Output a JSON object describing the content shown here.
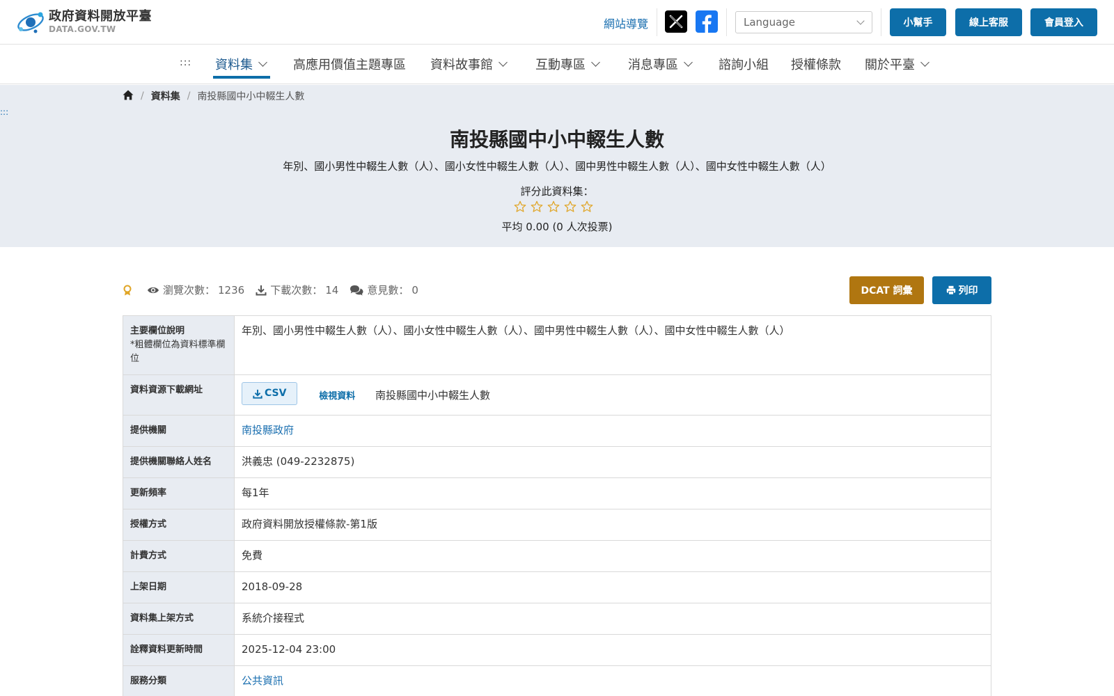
{
  "header": {
    "logo_title": "政府資料開放平臺",
    "logo_sub": "DATA.GOV.TW",
    "sitemap": "網站導覽",
    "language_placeholder": "Language",
    "buttons": [
      "小幫手",
      "線上客服",
      "會員登入"
    ]
  },
  "nav": {
    "accesskey": ":::",
    "items": [
      {
        "label": "資料集",
        "dropdown": true
      },
      {
        "label": "高應用價值主題專區",
        "dropdown": false
      },
      {
        "label": "資料故事館",
        "dropdown": true
      },
      {
        "label": "互動專區",
        "dropdown": true
      },
      {
        "label": "消息專區",
        "dropdown": true
      },
      {
        "label": "諮詢小組",
        "dropdown": false
      },
      {
        "label": "授權條款",
        "dropdown": false
      },
      {
        "label": "關於平臺",
        "dropdown": true
      }
    ]
  },
  "breadcrumb": {
    "level1": "資料集",
    "current": "南投縣國中小中輟生人數"
  },
  "hero": {
    "accesskey": ":::",
    "title": "南投縣國中小中輟生人數",
    "description": "年別、國小男性中輟生人數（人）、國小女性中輟生人數（人）、國中男性中輟生人數（人）、國中女性中輟生人數（人）",
    "rate_label": "評分此資料集：",
    "rating_value": 0,
    "rating_max": 5,
    "average": "平均 0.00 (0 人次投票)"
  },
  "stats": {
    "views_label": "瀏覽次數：",
    "views_value": "1236",
    "downloads_label": "下載次數：",
    "downloads_value": "14",
    "comments_label": "意見數：",
    "comments_value": "0"
  },
  "actions": {
    "dcat": "DCAT 詞彙",
    "print": "列印"
  },
  "details": {
    "main_fields_label": "主要欄位說明",
    "main_fields_note": "*粗體欄位為資料標準欄位",
    "main_fields_value": "年別、國小男性中輟生人數（人）、國小女性中輟生人數（人）、國中男性中輟生人數（人）、國中女性中輟生人數（人）",
    "resource_label": "資料資源下載網址",
    "csv_label": "CSV",
    "view_label": "檢視資料",
    "resource_name": "南投縣國中小中輟生人數",
    "rows": [
      {
        "label": "提供機關",
        "value": "南投縣政府",
        "link": true
      },
      {
        "label": "提供機關聯絡人姓名",
        "value": "洪義忠 (049-2232875)",
        "link": false
      },
      {
        "label": "更新頻率",
        "value": "每1年",
        "link": false
      },
      {
        "label": "授權方式",
        "value": "政府資料開放授權條款-第1版",
        "link": false
      },
      {
        "label": "計費方式",
        "value": "免費",
        "link": false
      },
      {
        "label": "上架日期",
        "value": "2018-09-28",
        "link": false
      },
      {
        "label": "資料集上架方式",
        "value": "系統介接程式",
        "link": false
      },
      {
        "label": "詮釋資料更新時間",
        "value": "2025-12-04 23:00",
        "link": false
      },
      {
        "label": "服務分類",
        "value": "公共資訊",
        "link": true
      }
    ]
  },
  "colors": {
    "primary": "#0d6ea9",
    "dcat": "#b07610",
    "hero_bg": "#e8ecf2",
    "star": "#e0a526"
  }
}
